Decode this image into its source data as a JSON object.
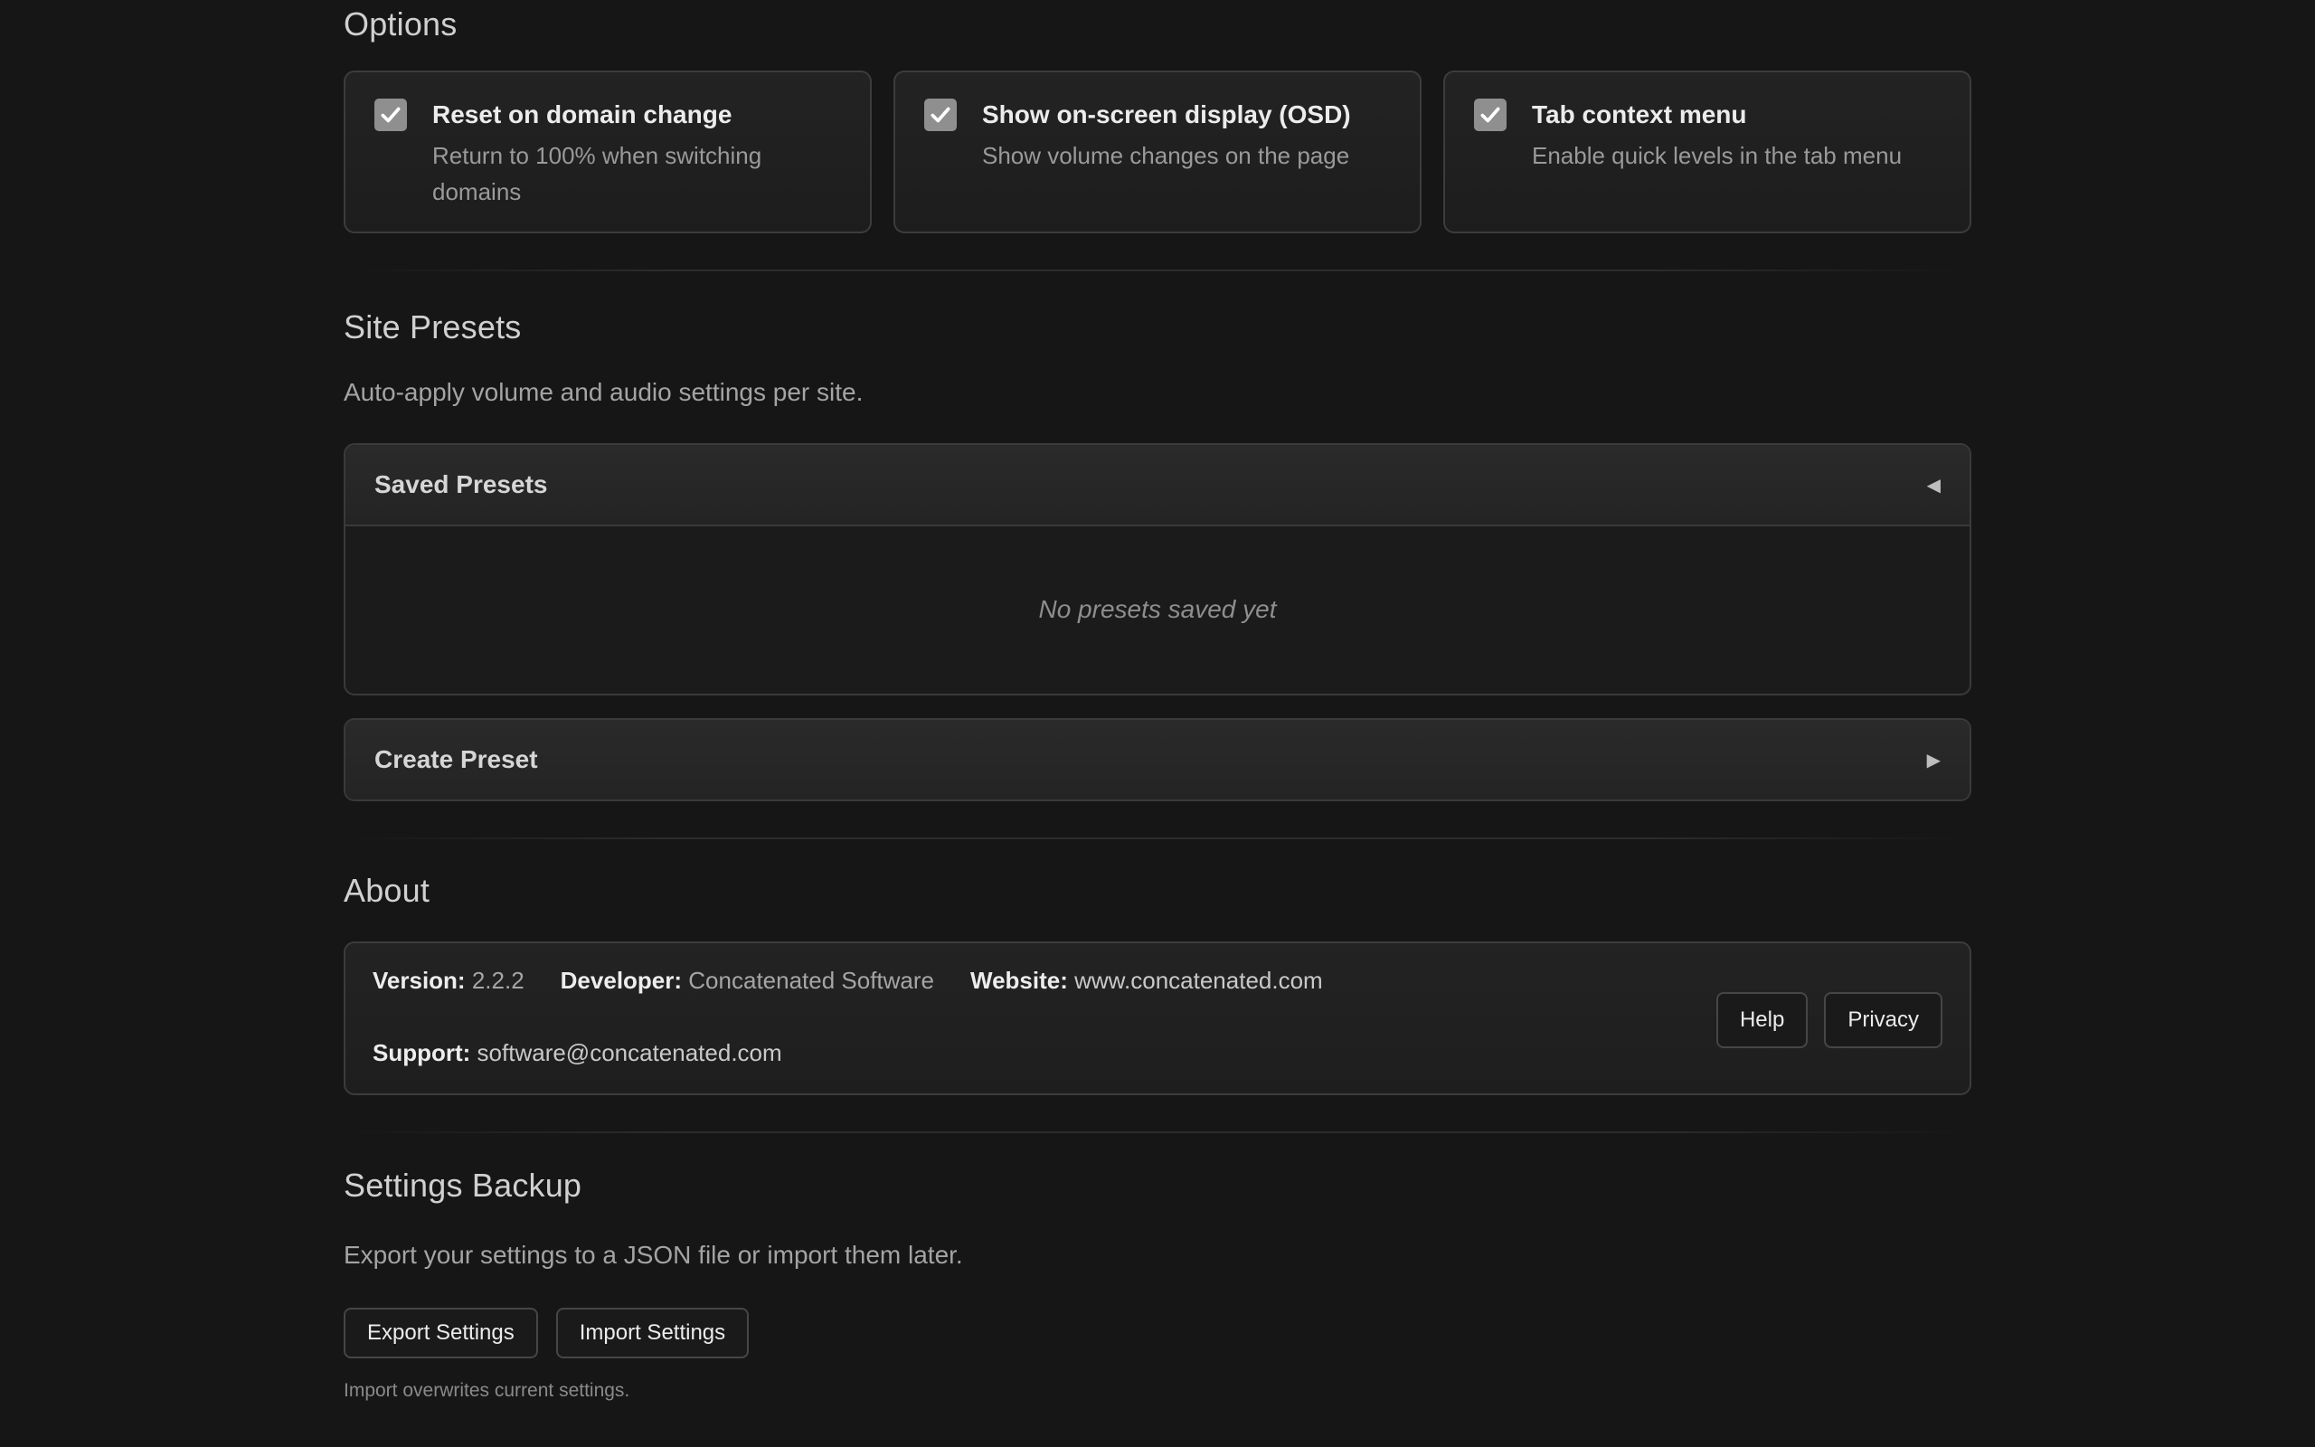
{
  "options": {
    "title": "Options",
    "items": [
      {
        "label": "Reset on domain change",
        "description": "Return to 100% when switching domains",
        "checked": true
      },
      {
        "label": "Show on-screen display (OSD)",
        "description": "Show volume changes on the page",
        "checked": true
      },
      {
        "label": "Tab context menu",
        "description": "Enable quick levels in the tab menu",
        "checked": true
      }
    ]
  },
  "site_presets": {
    "title": "Site Presets",
    "description": "Auto-apply volume and audio settings per site.",
    "saved_panel": {
      "title": "Saved Presets",
      "caret": "◀",
      "empty_text": "No presets saved yet"
    },
    "create_panel": {
      "title": "Create Preset",
      "caret": "▶"
    }
  },
  "about": {
    "title": "About",
    "version_label": "Version:",
    "version_value": "2.2.2",
    "developer_label": "Developer:",
    "developer_value": "Concatenated Software",
    "website_label": "Website:",
    "website_value": "www.concatenated.com",
    "support_label": "Support:",
    "support_value": "software@concatenated.com",
    "help_button": "Help",
    "privacy_button": "Privacy"
  },
  "backup": {
    "title": "Settings Backup",
    "description": "Export your settings to a JSON file or import them later.",
    "export_button": "Export Settings",
    "import_button": "Import Settings",
    "note": "Import overwrites current settings."
  },
  "colors": {
    "background": "#161616",
    "card_border": "#3c3c3c",
    "checkbox": "#8f8f8f"
  }
}
